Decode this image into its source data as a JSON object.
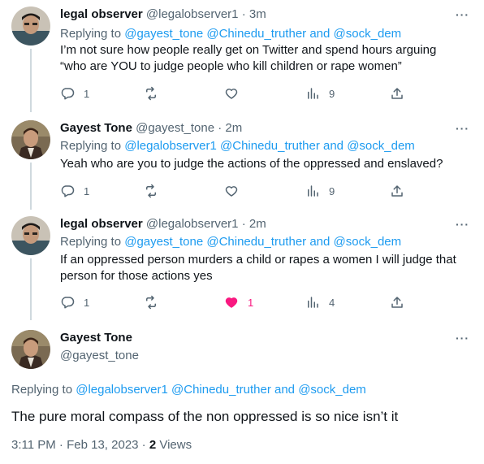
{
  "tweets": [
    {
      "name": "legal observer",
      "handle": "@legalobserver1",
      "time": "3m",
      "replying_prefix": "Replying to",
      "reply_handles": [
        "@gayest_tone",
        "@Chinedu_truther"
      ],
      "reply_and": "and",
      "reply_last": "@sock_dem",
      "text_lines": [
        "I’m not sure how people really get on Twitter and spend hours arguing",
        "“who are YOU to judge people who kill children or rape women”"
      ],
      "replies": "1",
      "retweets": "",
      "likes": "",
      "views": "9",
      "liked": false
    },
    {
      "name": "Gayest Tone",
      "handle": "@gayest_tone",
      "time": "2m",
      "replying_prefix": "Replying to",
      "reply_handles": [
        "@legalobserver1",
        "@Chinedu_truther"
      ],
      "reply_and": "and",
      "reply_last": "@sock_dem",
      "text_lines": [
        "Yeah who are you to judge the actions of the oppressed and enslaved?"
      ],
      "replies": "1",
      "retweets": "",
      "likes": "",
      "views": "9",
      "liked": false
    },
    {
      "name": "legal observer",
      "handle": "@legalobserver1",
      "time": "2m",
      "replying_prefix": "Replying to",
      "reply_handles": [
        "@gayest_tone",
        "@Chinedu_truther"
      ],
      "reply_and": "and",
      "reply_last": "@sock_dem",
      "text_lines": [
        "If an oppressed person murders a child or rapes a women I will judge that",
        "person for those actions yes"
      ],
      "replies": "1",
      "retweets": "",
      "likes": "1",
      "views": "4",
      "liked": true
    }
  ],
  "main_tweet": {
    "name": "Gayest Tone",
    "handle": "@gayest_tone",
    "replying_prefix": "Replying to",
    "reply_handles": [
      "@legalobserver1",
      "@Chinedu_truther"
    ],
    "reply_and": "and",
    "reply_last": "@sock_dem",
    "text": "The pure moral compass of the non oppressed is so nice isn’t it",
    "time": "3:11 PM",
    "date": "Feb 13, 2023",
    "views_count": "2",
    "views_label": "Views"
  },
  "separator": "·",
  "more_glyph": "···",
  "icons": {
    "reply": "reply-icon",
    "retweet": "retweet-icon",
    "like": "heart-icon",
    "views": "views-icon",
    "share": "share-icon",
    "more": "more-icon"
  },
  "colors": {
    "link": "#1d9bf0",
    "secondary_text": "#536471",
    "like_active": "#f91880",
    "thread_line": "#cfd9de"
  }
}
